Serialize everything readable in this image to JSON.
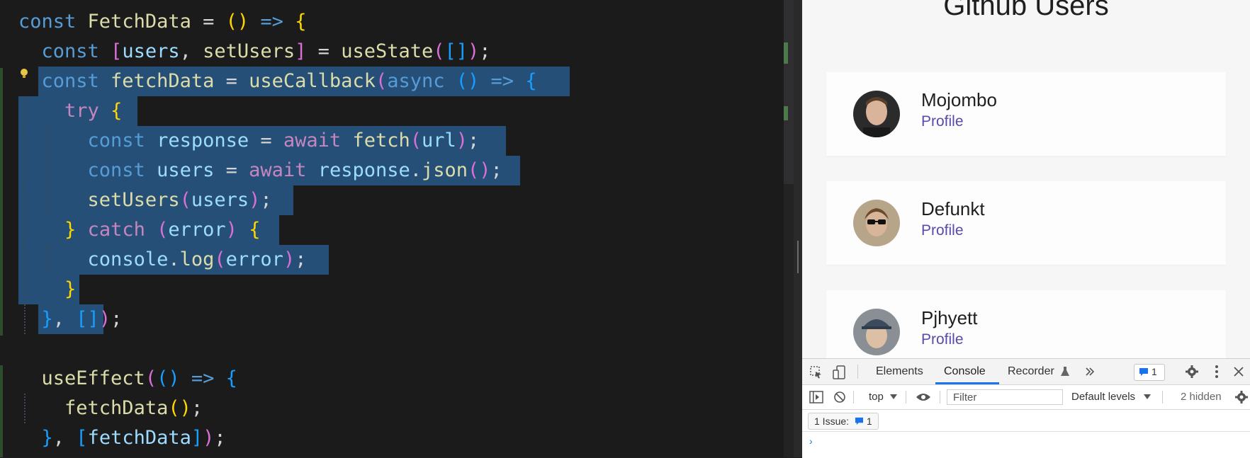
{
  "editor": {
    "lines": [
      [
        {
          "t": "const ",
          "c": "kw"
        },
        {
          "t": "FetchData",
          "c": "fn"
        },
        {
          "t": " = ",
          "c": "p"
        },
        {
          "t": "()",
          "c": "b1"
        },
        {
          "t": " ",
          "c": "p"
        },
        {
          "t": "=>",
          "c": "kw"
        },
        {
          "t": " ",
          "c": "p"
        },
        {
          "t": "{",
          "c": "b1"
        }
      ],
      [
        {
          "t": "  const ",
          "c": "kw"
        },
        {
          "t": "[",
          "c": "b2"
        },
        {
          "t": "users",
          "c": "var"
        },
        {
          "t": ", ",
          "c": "p"
        },
        {
          "t": "setUsers",
          "c": "fn"
        },
        {
          "t": "]",
          "c": "b2"
        },
        {
          "t": " = ",
          "c": "p"
        },
        {
          "t": "useState",
          "c": "fn"
        },
        {
          "t": "(",
          "c": "b2"
        },
        {
          "t": "[]",
          "c": "b3"
        },
        {
          "t": ")",
          "c": "b2"
        },
        {
          "t": ";",
          "c": "p"
        }
      ],
      [
        {
          "t": "  const ",
          "c": "kw"
        },
        {
          "t": "fetchData",
          "c": "fn"
        },
        {
          "t": " = ",
          "c": "p"
        },
        {
          "t": "useCallback",
          "c": "fn"
        },
        {
          "t": "(",
          "c": "b2"
        },
        {
          "t": "async",
          "c": "kw"
        },
        {
          "t": " ",
          "c": "p"
        },
        {
          "t": "()",
          "c": "b3"
        },
        {
          "t": " ",
          "c": "p"
        },
        {
          "t": "=>",
          "c": "kw"
        },
        {
          "t": " ",
          "c": "p"
        },
        {
          "t": "{",
          "c": "b3"
        }
      ],
      [
        {
          "t": "    ",
          "c": "p"
        },
        {
          "t": "try",
          "c": "ctrl"
        },
        {
          "t": " ",
          "c": "p"
        },
        {
          "t": "{",
          "c": "b1"
        }
      ],
      [
        {
          "t": "      const ",
          "c": "kw"
        },
        {
          "t": "response",
          "c": "var"
        },
        {
          "t": " = ",
          "c": "p"
        },
        {
          "t": "await",
          "c": "ctrl"
        },
        {
          "t": " ",
          "c": "p"
        },
        {
          "t": "fetch",
          "c": "fn"
        },
        {
          "t": "(",
          "c": "b2"
        },
        {
          "t": "url",
          "c": "var"
        },
        {
          "t": ")",
          "c": "b2"
        },
        {
          "t": ";",
          "c": "p"
        }
      ],
      [
        {
          "t": "      const ",
          "c": "kw"
        },
        {
          "t": "users",
          "c": "var"
        },
        {
          "t": " = ",
          "c": "p"
        },
        {
          "t": "await",
          "c": "ctrl"
        },
        {
          "t": " ",
          "c": "p"
        },
        {
          "t": "response",
          "c": "var"
        },
        {
          "t": ".",
          "c": "p"
        },
        {
          "t": "json",
          "c": "fn"
        },
        {
          "t": "()",
          "c": "b2"
        },
        {
          "t": ";",
          "c": "p"
        }
      ],
      [
        {
          "t": "      ",
          "c": "p"
        },
        {
          "t": "setUsers",
          "c": "fn"
        },
        {
          "t": "(",
          "c": "b2"
        },
        {
          "t": "users",
          "c": "var"
        },
        {
          "t": ")",
          "c": "b2"
        },
        {
          "t": ";",
          "c": "p"
        }
      ],
      [
        {
          "t": "    ",
          "c": "p"
        },
        {
          "t": "}",
          "c": "b1"
        },
        {
          "t": " ",
          "c": "p"
        },
        {
          "t": "catch",
          "c": "ctrl"
        },
        {
          "t": " ",
          "c": "p"
        },
        {
          "t": "(",
          "c": "b2"
        },
        {
          "t": "error",
          "c": "var"
        },
        {
          "t": ")",
          "c": "b2"
        },
        {
          "t": " ",
          "c": "p"
        },
        {
          "t": "{",
          "c": "b1"
        }
      ],
      [
        {
          "t": "      ",
          "c": "p"
        },
        {
          "t": "console",
          "c": "var"
        },
        {
          "t": ".",
          "c": "p"
        },
        {
          "t": "log",
          "c": "fn"
        },
        {
          "t": "(",
          "c": "b2"
        },
        {
          "t": "error",
          "c": "var"
        },
        {
          "t": ")",
          "c": "b2"
        },
        {
          "t": ";",
          "c": "p"
        }
      ],
      [
        {
          "t": "    ",
          "c": "p"
        },
        {
          "t": "}",
          "c": "b1"
        }
      ],
      [
        {
          "t": "  ",
          "c": "p"
        },
        {
          "t": "}",
          "c": "b3"
        },
        {
          "t": ", ",
          "c": "p"
        },
        {
          "t": "[]",
          "c": "b3"
        },
        {
          "t": ")",
          "c": "b2"
        },
        {
          "t": ";",
          "c": "p"
        }
      ],
      [],
      [
        {
          "t": "  ",
          "c": "p"
        },
        {
          "t": "useEffect",
          "c": "fn"
        },
        {
          "t": "(",
          "c": "b2"
        },
        {
          "t": "()",
          "c": "b3"
        },
        {
          "t": " ",
          "c": "p"
        },
        {
          "t": "=>",
          "c": "kw"
        },
        {
          "t": " ",
          "c": "p"
        },
        {
          "t": "{",
          "c": "b3"
        }
      ],
      [
        {
          "t": "    ",
          "c": "p"
        },
        {
          "t": "fetchData",
          "c": "fn"
        },
        {
          "t": "()",
          "c": "b1"
        },
        {
          "t": ";",
          "c": "p"
        }
      ],
      [
        {
          "t": "  ",
          "c": "p"
        },
        {
          "t": "}",
          "c": "b3"
        },
        {
          "t": ", ",
          "c": "p"
        },
        {
          "t": "[",
          "c": "b3"
        },
        {
          "t": "fetchData",
          "c": "var"
        },
        {
          "t": "]",
          "c": "b3"
        },
        {
          "t": ")",
          "c": "b2"
        },
        {
          "t": ";",
          "c": "p"
        }
      ]
    ]
  },
  "browser": {
    "title": "Github Users",
    "users": [
      {
        "name": "Mojombo",
        "link": "Profile",
        "avatar": "avatar-mojombo"
      },
      {
        "name": "Defunkt",
        "link": "Profile",
        "avatar": "avatar-defunkt"
      },
      {
        "name": "Pjhyett",
        "link": "Profile",
        "avatar": "avatar-pjhyett"
      }
    ]
  },
  "devtools": {
    "tabs": [
      "Elements",
      "Console",
      "Recorder"
    ],
    "active_tab": "Console",
    "more_tabs_icon": "double-chevron-icon",
    "issue_count": "1",
    "context": "top",
    "filter_placeholder": "Filter",
    "levels": "Default levels",
    "hidden": "2 hidden",
    "issues_label": "1 Issue:",
    "issues_count": "1",
    "prompt": "›"
  },
  "colors": {
    "selection": "#264f78",
    "keyword": "#569cd6",
    "function": "#dcdcaa",
    "variable": "#9cdcfe",
    "control": "#c586c0",
    "link": "#5b4aa8",
    "devtools_accent": "#1a73e8"
  }
}
